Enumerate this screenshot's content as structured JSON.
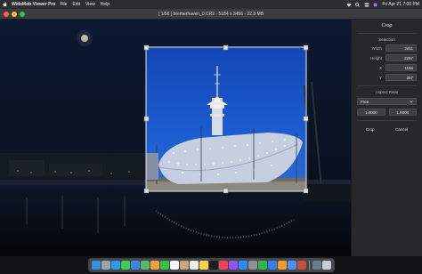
{
  "menubar": {
    "app_name": "WidsMob Viewer Pro",
    "items": [
      "File",
      "Edit",
      "View",
      "Help"
    ],
    "clock": "Fri Apr 21  7:00 PM"
  },
  "window": {
    "title": "[ 1/56 ]  bremerhaven_0.CR2  -  5184 x 3456  -  22.3 MB"
  },
  "panel": {
    "title": "Crop",
    "selection_label": "Selection",
    "width_label": "Width",
    "width_value": "2411",
    "height_label": "Height",
    "height_value": "2257",
    "x_label": "X",
    "x_value": "1156",
    "y_label": "Y",
    "y_value": "357",
    "aspect_label": "Aspect Ratio",
    "aspect_value": "Free",
    "ratio_w": "1.0000",
    "ratio_h": "1.0000",
    "crop_button": "Crop",
    "cancel_button": "Cancel"
  },
  "crop": {
    "width_fraction": 0.465,
    "height_fraction": 0.653
  },
  "dock": {
    "apps": [
      {
        "name": "finder-icon",
        "color": "#3a8ee6"
      },
      {
        "name": "launchpad-icon",
        "color": "#9aa3b0"
      },
      {
        "name": "safari-icon",
        "color": "#2f9be8"
      },
      {
        "name": "messages-icon",
        "color": "#3ccf4e"
      },
      {
        "name": "mail-icon",
        "color": "#3a87f0"
      },
      {
        "name": "maps-icon",
        "color": "#55b86a"
      },
      {
        "name": "photos-icon",
        "color": "#f2a13a"
      },
      {
        "name": "facetime-icon",
        "color": "#35c24e"
      },
      {
        "name": "calendar-icon",
        "color": "#f4f4f4"
      },
      {
        "name": "contacts-icon",
        "color": "#c9a77a"
      },
      {
        "name": "reminders-icon",
        "color": "#f1f1f1"
      },
      {
        "name": "notes-icon",
        "color": "#f5d547"
      },
      {
        "name": "tv-icon",
        "color": "#1d1d1f"
      },
      {
        "name": "music-icon",
        "color": "#f6405a"
      },
      {
        "name": "podcasts-icon",
        "color": "#9a4ff0"
      },
      {
        "name": "appstore-icon",
        "color": "#2a8cf0"
      },
      {
        "name": "settings-icon",
        "color": "#8e8e93"
      },
      {
        "name": "numbers-icon",
        "color": "#2fb84a"
      },
      {
        "name": "keynote-icon",
        "color": "#2f7ff0"
      },
      {
        "name": "pages-icon",
        "color": "#f29a30"
      },
      {
        "name": "xcode-icon",
        "color": "#4c8ff0"
      },
      {
        "name": "widsmob-icon",
        "color": "#c74f3a"
      }
    ],
    "others": [
      {
        "name": "downloads-icon",
        "color": "#6b7a8c"
      },
      {
        "name": "trash-icon",
        "color": "#c9ccd2"
      }
    ]
  }
}
